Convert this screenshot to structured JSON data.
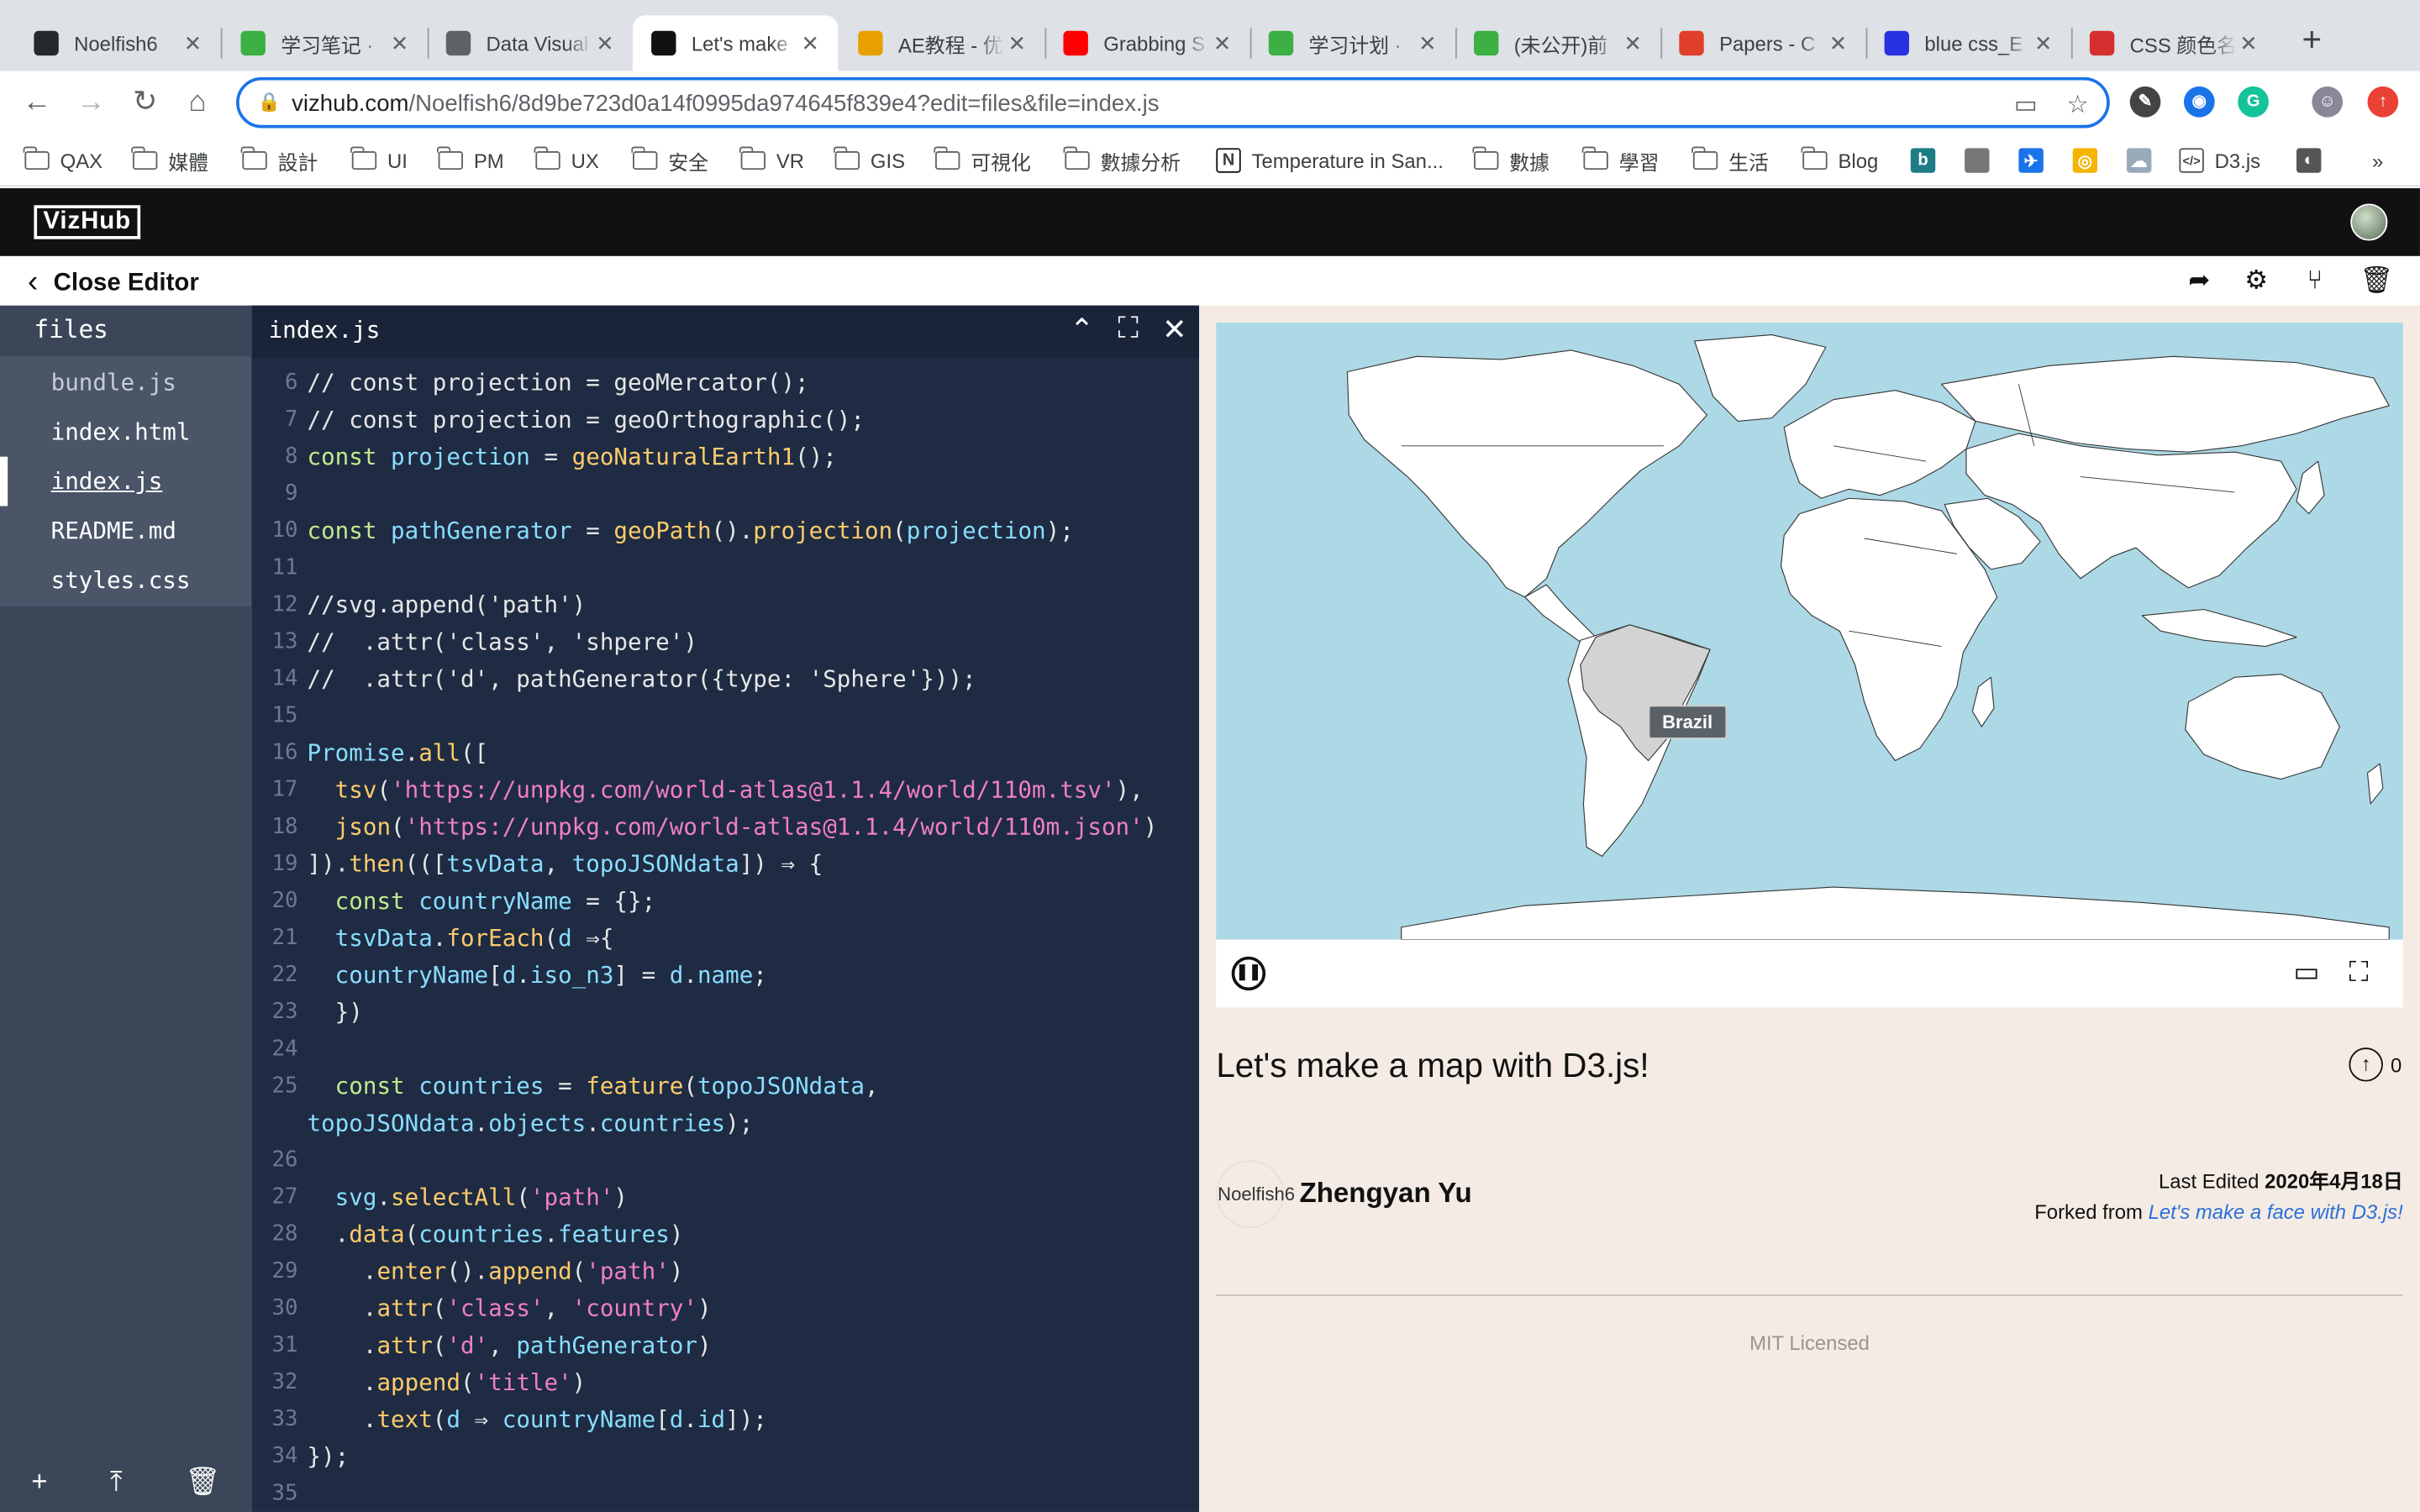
{
  "browser": {
    "tabs": [
      {
        "title": "Noelfish6",
        "icon": "github-icon",
        "color": "#24292e"
      },
      {
        "title": "学习笔记 ·",
        "icon": "leaf-icon",
        "color": "#3cb043"
      },
      {
        "title": "Data Visual",
        "icon": "globe-icon",
        "color": "#5f6368"
      },
      {
        "title": "Let's make",
        "icon": "notion-icon",
        "color": "#111111"
      },
      {
        "title": "AE教程 - 优",
        "icon": "tiger-icon",
        "color": "#e8a000"
      },
      {
        "title": "Grabbing S",
        "icon": "youtube-icon",
        "color": "#ff0000"
      },
      {
        "title": "学习计划 ·",
        "icon": "leaf-icon",
        "color": "#3cb043"
      },
      {
        "title": "(未公开)前",
        "icon": "leaf-icon",
        "color": "#3cb043"
      },
      {
        "title": "Papers - C",
        "icon": "flower-icon",
        "color": "#e0402a"
      },
      {
        "title": "blue css_E",
        "icon": "baidu-icon",
        "color": "#2932e1"
      },
      {
        "title": "CSS 颜色名",
        "icon": "shield-icon",
        "color": "#d62f2f"
      }
    ],
    "url_host": "vizhub.com",
    "url_path": "/Noelfish6/8d9be723d0a14f0995da974645f839e4?edit=files&file=index.js",
    "bookmarks": [
      "QAX",
      "媒體",
      "設計",
      "UI",
      "PM",
      "UX",
      "安全",
      "VR",
      "GIS",
      "可視化",
      "數據分析",
      "Temperature in San...",
      "數據",
      "學習",
      "生活",
      "Blog",
      "D3.js"
    ],
    "more": "»"
  },
  "vizhub": {
    "logo": "VizHub",
    "close_editor": "Close Editor",
    "files_title": "files",
    "files": [
      "bundle.js",
      "index.html",
      "index.js",
      "README.md",
      "styles.css"
    ],
    "active_file": "index.js",
    "editor_title": "index.js",
    "code_lines": [
      {
        "n": "6",
        "t": [
          [
            "c-com",
            "// const projection = geoMercator();"
          ]
        ]
      },
      {
        "n": "7",
        "t": [
          [
            "c-com",
            "// const projection = geoOrthographic();"
          ]
        ]
      },
      {
        "n": "8",
        "t": [
          [
            "c-kw",
            "const "
          ],
          [
            "c-var",
            "projection"
          ],
          [
            "c-plain",
            " = "
          ],
          [
            "c-fn",
            "geoNaturalEarth1"
          ],
          [
            "c-plain",
            "();"
          ]
        ]
      },
      {
        "n": "9",
        "t": []
      },
      {
        "n": "10",
        "t": [
          [
            "c-kw",
            "const "
          ],
          [
            "c-var",
            "pathGenerator"
          ],
          [
            "c-plain",
            " = "
          ],
          [
            "c-fn",
            "geoPath"
          ],
          [
            "c-plain",
            "()."
          ],
          [
            "c-fn",
            "projection"
          ],
          [
            "c-plain",
            "("
          ],
          [
            "c-var",
            "projection"
          ],
          [
            "c-plain",
            ");"
          ]
        ]
      },
      {
        "n": "11",
        "t": []
      },
      {
        "n": "12",
        "t": [
          [
            "c-com",
            "//svg.append('path')"
          ]
        ]
      },
      {
        "n": "13",
        "t": [
          [
            "c-com",
            "//  .attr('class', 'shpere')"
          ]
        ]
      },
      {
        "n": "14",
        "t": [
          [
            "c-com",
            "//  .attr('d', pathGenerator({type: 'Sphere'}));"
          ]
        ]
      },
      {
        "n": "15",
        "t": []
      },
      {
        "n": "16",
        "t": [
          [
            "c-var",
            "Promise"
          ],
          [
            "c-plain",
            "."
          ],
          [
            "c-fn",
            "all"
          ],
          [
            "c-plain",
            "(["
          ]
        ]
      },
      {
        "n": "17",
        "t": [
          [
            "c-plain",
            "  "
          ],
          [
            "c-fn",
            "tsv"
          ],
          [
            "c-plain",
            "("
          ],
          [
            "c-str",
            "'https://unpkg.com/world-atlas@1.1.4/world/110m.tsv'"
          ],
          [
            "c-plain",
            "),"
          ]
        ]
      },
      {
        "n": "18",
        "t": [
          [
            "c-plain",
            "  "
          ],
          [
            "c-fn",
            "json"
          ],
          [
            "c-plain",
            "("
          ],
          [
            "c-str",
            "'https://unpkg.com/world-atlas@1.1.4/world/110m.json'"
          ],
          [
            "c-plain",
            ")"
          ]
        ]
      },
      {
        "n": "19",
        "t": [
          [
            "c-plain",
            "])."
          ],
          [
            "c-fn",
            "then"
          ],
          [
            "c-plain",
            "((["
          ],
          [
            "c-var",
            "tsvData"
          ],
          [
            "c-plain",
            ", "
          ],
          [
            "c-var",
            "topoJSONdata"
          ],
          [
            "c-plain",
            "]) ⇒ {"
          ]
        ]
      },
      {
        "n": "20",
        "t": [
          [
            "c-plain",
            "  "
          ],
          [
            "c-kw",
            "const "
          ],
          [
            "c-var",
            "countryName"
          ],
          [
            "c-plain",
            " = {};"
          ]
        ]
      },
      {
        "n": "21",
        "t": [
          [
            "c-plain",
            "  "
          ],
          [
            "c-var",
            "tsvData"
          ],
          [
            "c-plain",
            "."
          ],
          [
            "c-fn",
            "forEach"
          ],
          [
            "c-plain",
            "("
          ],
          [
            "c-var",
            "d"
          ],
          [
            "c-plain",
            " ⇒{"
          ]
        ]
      },
      {
        "n": "22",
        "t": [
          [
            "c-plain",
            "  "
          ],
          [
            "c-var",
            "countryName"
          ],
          [
            "c-plain",
            "["
          ],
          [
            "c-var",
            "d"
          ],
          [
            "c-plain",
            "."
          ],
          [
            "c-var",
            "iso_n3"
          ],
          [
            "c-plain",
            "] = "
          ],
          [
            "c-var",
            "d"
          ],
          [
            "c-plain",
            "."
          ],
          [
            "c-var",
            "name"
          ],
          [
            "c-plain",
            ";"
          ]
        ]
      },
      {
        "n": "23",
        "t": [
          [
            "c-plain",
            "  })"
          ]
        ]
      },
      {
        "n": "24",
        "t": []
      },
      {
        "n": "25",
        "t": [
          [
            "c-plain",
            "  "
          ],
          [
            "c-kw",
            "const "
          ],
          [
            "c-var",
            "countries"
          ],
          [
            "c-plain",
            " = "
          ],
          [
            "c-fn",
            "feature"
          ],
          [
            "c-plain",
            "("
          ],
          [
            "c-var",
            "topoJSONdata"
          ],
          [
            "c-plain",
            ","
          ]
        ]
      },
      {
        "n": "",
        "t": [
          [
            "c-var",
            "topoJSONdata"
          ],
          [
            "c-plain",
            "."
          ],
          [
            "c-var",
            "objects"
          ],
          [
            "c-plain",
            "."
          ],
          [
            "c-var",
            "countries"
          ],
          [
            "c-plain",
            ");"
          ]
        ]
      },
      {
        "n": "26",
        "t": []
      },
      {
        "n": "27",
        "t": [
          [
            "c-plain",
            "  "
          ],
          [
            "c-var",
            "svg"
          ],
          [
            "c-plain",
            "."
          ],
          [
            "c-fn",
            "selectAll"
          ],
          [
            "c-plain",
            "("
          ],
          [
            "c-str",
            "'path'"
          ],
          [
            "c-plain",
            ")"
          ]
        ]
      },
      {
        "n": "28",
        "t": [
          [
            "c-plain",
            "  ."
          ],
          [
            "c-fn",
            "data"
          ],
          [
            "c-plain",
            "("
          ],
          [
            "c-var",
            "countries"
          ],
          [
            "c-plain",
            "."
          ],
          [
            "c-var",
            "features"
          ],
          [
            "c-plain",
            ")"
          ]
        ]
      },
      {
        "n": "29",
        "t": [
          [
            "c-plain",
            "    ."
          ],
          [
            "c-fn",
            "enter"
          ],
          [
            "c-plain",
            "()."
          ],
          [
            "c-fn",
            "append"
          ],
          [
            "c-plain",
            "("
          ],
          [
            "c-str",
            "'path'"
          ],
          [
            "c-plain",
            ")"
          ]
        ]
      },
      {
        "n": "30",
        "t": [
          [
            "c-plain",
            "    ."
          ],
          [
            "c-fn",
            "attr"
          ],
          [
            "c-plain",
            "("
          ],
          [
            "c-str",
            "'class'"
          ],
          [
            "c-plain",
            ", "
          ],
          [
            "c-str",
            "'country'"
          ],
          [
            "c-plain",
            ")"
          ]
        ]
      },
      {
        "n": "31",
        "t": [
          [
            "c-plain",
            "    ."
          ],
          [
            "c-fn",
            "attr"
          ],
          [
            "c-plain",
            "("
          ],
          [
            "c-str",
            "'d'"
          ],
          [
            "c-plain",
            ", "
          ],
          [
            "c-var",
            "pathGenerator"
          ],
          [
            "c-plain",
            ")"
          ]
        ]
      },
      {
        "n": "32",
        "t": [
          [
            "c-plain",
            "    ."
          ],
          [
            "c-fn",
            "append"
          ],
          [
            "c-plain",
            "("
          ],
          [
            "c-str",
            "'title'"
          ],
          [
            "c-plain",
            ")"
          ]
        ]
      },
      {
        "n": "33",
        "t": [
          [
            "c-plain",
            "    ."
          ],
          [
            "c-fn",
            "text"
          ],
          [
            "c-plain",
            "("
          ],
          [
            "c-var",
            "d"
          ],
          [
            "c-plain",
            " ⇒ "
          ],
          [
            "c-var",
            "countryName"
          ],
          [
            "c-plain",
            "["
          ],
          [
            "c-var",
            "d"
          ],
          [
            "c-plain",
            "."
          ],
          [
            "c-var",
            "id"
          ],
          [
            "c-plain",
            "]);"
          ]
        ]
      },
      {
        "n": "34",
        "t": [
          [
            "c-plain",
            "});"
          ]
        ]
      },
      {
        "n": "35",
        "t": []
      }
    ],
    "tooltip": "Brazil",
    "viz_title": "Let's make a map with D3.js!",
    "upvotes": "0",
    "author_avatar_alt": "Noelfish6",
    "author": "Zhengyan Yu",
    "last_edited_label": "Last Edited",
    "last_edited_date": "2020年4月18日",
    "forked_from_label": "Forked from",
    "forked_from_link": "Let's make a face with D3.js!",
    "license": "MIT Licensed",
    "colors": {
      "ocean": "#add8e6",
      "land": "#ffffff",
      "highlight": "#d3d3d3",
      "code_bg": "#1e2b43"
    }
  }
}
